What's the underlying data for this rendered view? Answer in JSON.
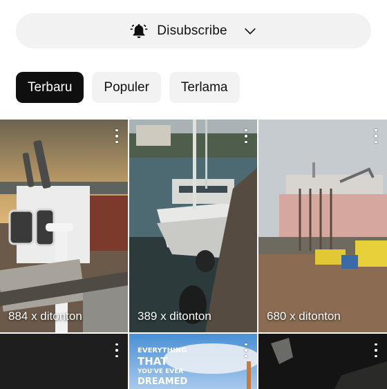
{
  "subscribe": {
    "label": "Disubscribe",
    "bell_icon": "bell-icon",
    "chevron_icon": "chevron-down-icon"
  },
  "filters": [
    {
      "label": "Terbaru",
      "active": true
    },
    {
      "label": "Populer",
      "active": false
    },
    {
      "label": "Terlama",
      "active": false
    }
  ],
  "videos": [
    {
      "views": "884 x ditonton"
    },
    {
      "views": "389 x ditonton"
    },
    {
      "views": "680 x ditonton"
    }
  ],
  "promo": {
    "line1": "EVERYTHING",
    "line2": "THAT",
    "line3": "YOU'VE EVER",
    "line4": "DREAMED"
  },
  "colors": {
    "active_chip": "#0f0f0f",
    "chip_bg": "#f2f2f2"
  }
}
